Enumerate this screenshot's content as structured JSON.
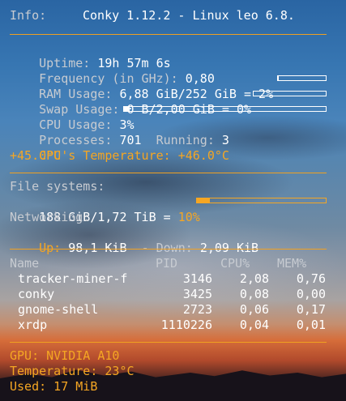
{
  "info": {
    "label": "Info:",
    "value": "Conky 1.12.2 - Linux leo 6.8."
  },
  "system": {
    "uptime_label": "Uptime:",
    "uptime": "19h 57m 6s",
    "freq_label": "Frequency (in GHz):",
    "freq": "0,80",
    "ram_label": "RAM Usage:",
    "ram": "6,88 GiB/252 GiB = 2%",
    "ram_pct": 2,
    "swap_label": "Swap Usage:",
    "swap": "0 B/2,00 GiB = 0%",
    "swap_pct": 0,
    "cpu_label": "CPU Usage:",
    "cpu": "3%",
    "cpu_pct": 3,
    "proc_label": "Processes:",
    "proc": "701",
    "running_label": "Running:",
    "running": "3",
    "cpu_temp_label": "CPU's Temperature:",
    "cpu_temp": "+46.0°C",
    "cpu_temp2": "+45.0°C"
  },
  "fs": {
    "label": "File systems:",
    "usage": "188 GiB/1,72 TiB =",
    "pct_text": "10%",
    "pct": 10,
    "net_label": "Networking:",
    "up_label": "Up:",
    "up": "98,1 KiB",
    "down_label": "- Down:",
    "down": "2,09 KiB"
  },
  "processes": {
    "headers": [
      "Name",
      "PID",
      "CPU%",
      "MEM%"
    ],
    "rows": [
      [
        "tracker-miner-f",
        "3146",
        "2,08",
        "0,76"
      ],
      [
        "conky",
        "3425",
        "0,08",
        "0,00"
      ],
      [
        "gnome-shell",
        "2723",
        "0,06",
        "0,17"
      ],
      [
        "xrdp",
        "1110226",
        "0,04",
        "0,01"
      ]
    ]
  },
  "gpu": {
    "name": "GPU: NVIDIA A10",
    "temp": "Temperature: 23°C",
    "used": "Used: 17 MiB"
  },
  "colors": {
    "accent": "#f5a623",
    "label": "#c7cbd1",
    "value": "#ffffff"
  }
}
